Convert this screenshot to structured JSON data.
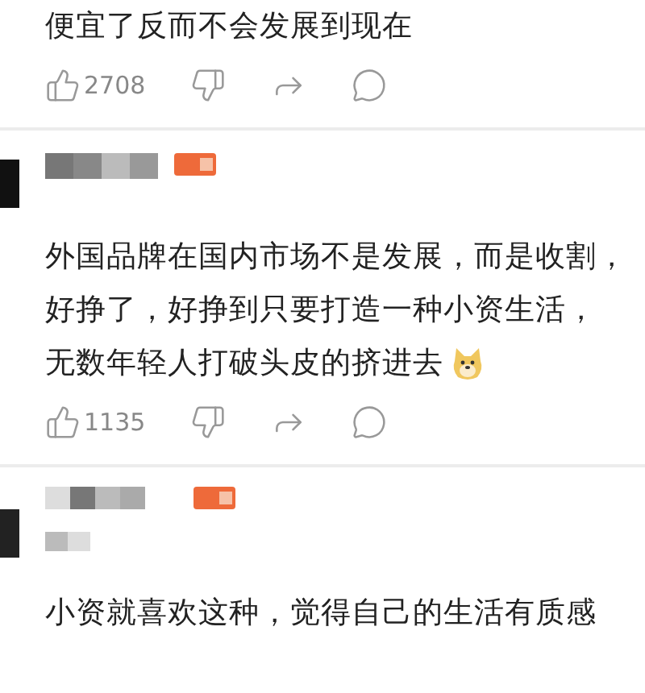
{
  "comments": [
    {
      "kind": "tail",
      "lines": [
        "便宜了反而不会发展到现在"
      ],
      "likes": "2708"
    },
    {
      "kind": "full",
      "lines": [
        "外国品牌在国内市场不是发展，而是收割，",
        "好挣了，好挣到只要打造一种小资生活，",
        "无数年轻人打破头皮的挤进去"
      ],
      "emoji": true,
      "likes": "1135"
    },
    {
      "kind": "head",
      "lines": [
        "小资就喜欢这种，觉得自己的生活有质感"
      ]
    }
  ]
}
